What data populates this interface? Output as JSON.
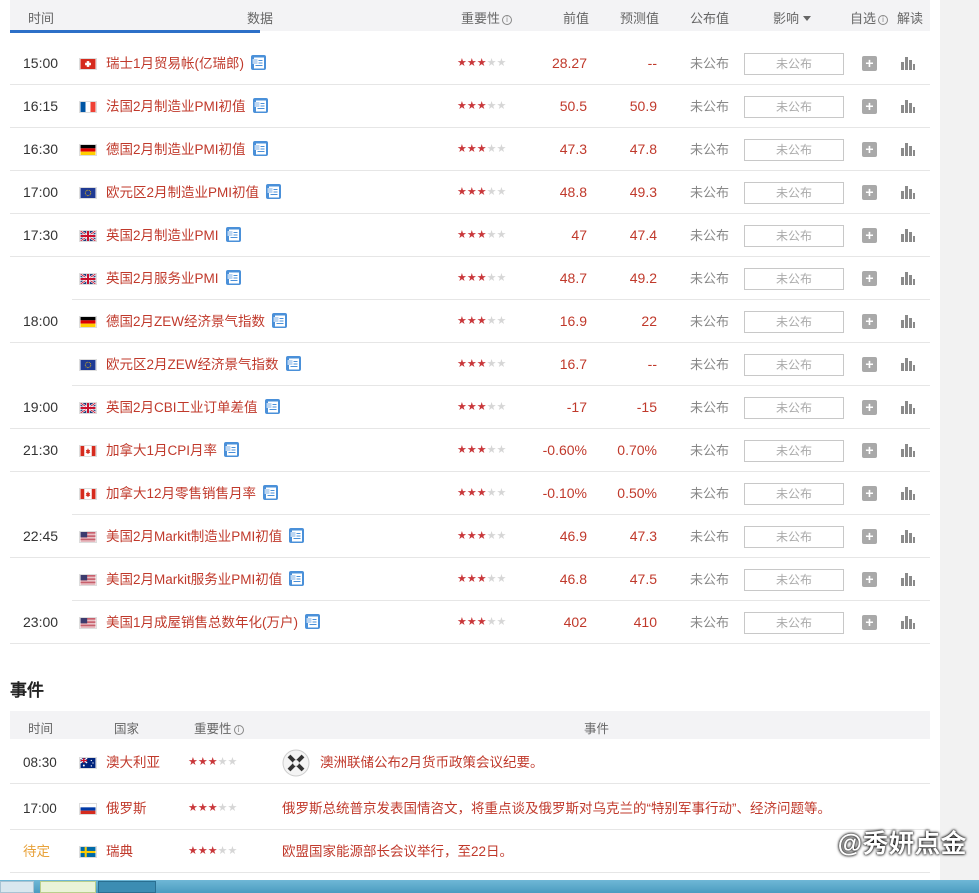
{
  "table": {
    "headers": {
      "time": "时间",
      "data": "数据",
      "importance": "重要性",
      "previous": "前值",
      "forecast": "预测值",
      "published": "公布值",
      "impact": "影响",
      "watch": "自选",
      "interpret": "解读"
    },
    "rows": [
      {
        "time": "15:00",
        "flag": "ch",
        "name": "瑞士1月贸易帐(亿瑞郎)",
        "stars": 3,
        "previous": "28.27",
        "forecast": "--",
        "published": "未公布",
        "impact": "未公布"
      },
      {
        "time": "16:15",
        "flag": "fr",
        "name": "法国2月制造业PMI初值",
        "stars": 3,
        "previous": "50.5",
        "forecast": "50.9",
        "published": "未公布",
        "impact": "未公布"
      },
      {
        "time": "16:30",
        "flag": "de",
        "name": "德国2月制造业PMI初值",
        "stars": 3,
        "previous": "47.3",
        "forecast": "47.8",
        "published": "未公布",
        "impact": "未公布"
      },
      {
        "time": "17:00",
        "flag": "eu",
        "name": "欧元区2月制造业PMI初值",
        "stars": 3,
        "previous": "48.8",
        "forecast": "49.3",
        "published": "未公布",
        "impact": "未公布"
      },
      {
        "time": "17:30",
        "flag": "gb",
        "name": "英国2月制造业PMI",
        "stars": 3,
        "previous": "47",
        "forecast": "47.4",
        "published": "未公布",
        "impact": "未公布"
      },
      {
        "time": "",
        "flag": "gb",
        "name": "英国2月服务业PMI",
        "stars": 3,
        "previous": "48.7",
        "forecast": "49.2",
        "published": "未公布",
        "impact": "未公布"
      },
      {
        "time": "18:00",
        "flag": "de",
        "name": "德国2月ZEW经济景气指数",
        "stars": 3,
        "previous": "16.9",
        "forecast": "22",
        "published": "未公布",
        "impact": "未公布"
      },
      {
        "time": "",
        "flag": "eu",
        "name": "欧元区2月ZEW经济景气指数",
        "stars": 3,
        "previous": "16.7",
        "forecast": "--",
        "published": "未公布",
        "impact": "未公布"
      },
      {
        "time": "19:00",
        "flag": "gb",
        "name": "英国2月CBI工业订单差值",
        "stars": 3,
        "previous": "-17",
        "forecast": "-15",
        "published": "未公布",
        "impact": "未公布"
      },
      {
        "time": "21:30",
        "flag": "ca",
        "name": "加拿大1月CPI月率",
        "stars": 3,
        "previous": "-0.60%",
        "forecast": "0.70%",
        "published": "未公布",
        "impact": "未公布"
      },
      {
        "time": "",
        "flag": "ca",
        "name": "加拿大12月零售销售月率",
        "stars": 3,
        "previous": "-0.10%",
        "forecast": "0.50%",
        "published": "未公布",
        "impact": "未公布"
      },
      {
        "time": "22:45",
        "flag": "us",
        "name": "美国2月Markit制造业PMI初值",
        "stars": 3,
        "previous": "46.9",
        "forecast": "47.3",
        "published": "未公布",
        "impact": "未公布"
      },
      {
        "time": "",
        "flag": "us",
        "name": "美国2月Markit服务业PMI初值",
        "stars": 3,
        "previous": "46.8",
        "forecast": "47.5",
        "published": "未公布",
        "impact": "未公布"
      },
      {
        "time": "23:00",
        "flag": "us",
        "name": "美国1月成屋销售总数年化(万户)",
        "stars": 3,
        "previous": "402",
        "forecast": "410",
        "published": "未公布",
        "impact": "未公布"
      }
    ]
  },
  "events": {
    "title": "事件",
    "headers": {
      "time": "时间",
      "country": "国家",
      "importance": "重要性",
      "event": "事件"
    },
    "rows": [
      {
        "time": "08:30",
        "flag": "au",
        "country": "澳大利亚",
        "stars": 3,
        "event": "澳洲联储公布2月货币政策会议纪要。",
        "pending": false,
        "logo": true
      },
      {
        "time": "17:00",
        "flag": "ru",
        "country": "俄罗斯",
        "stars": 3,
        "event": "俄罗斯总统普京发表国情咨文，将重点谈及俄罗斯对乌克兰的“特别军事行动”、经济问题等。",
        "pending": false,
        "logo": false
      },
      {
        "time": "待定",
        "flag": "se",
        "country": "瑞典",
        "stars": 3,
        "event": "欧盟国家能源部长会议举行，至22日。",
        "pending": true,
        "logo": false
      }
    ]
  },
  "watermark": "@秀妍点金",
  "colors": {
    "accent_red": "#c0392b",
    "star_red": "#c9373a",
    "tab_blue": "#2d70c8",
    "pending_orange": "#e8a23a"
  }
}
